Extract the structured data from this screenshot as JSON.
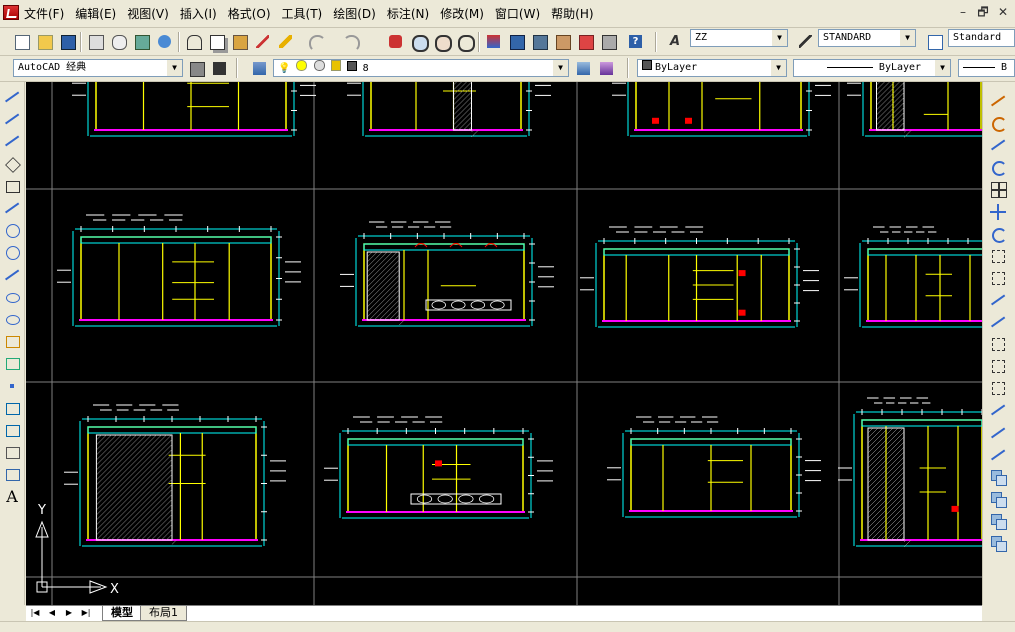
{
  "menu": {
    "items": [
      "文件(F)",
      "编辑(E)",
      "视图(V)",
      "插入(I)",
      "格式(O)",
      "工具(T)",
      "绘图(D)",
      "标注(N)",
      "修改(M)",
      "窗口(W)",
      "帮助(H)"
    ],
    "window_controls": [
      "–",
      "🗗",
      "✕"
    ]
  },
  "toolbar1": {
    "text_style": "ZZ",
    "dim_style": "STANDARD",
    "table_style": "Standard"
  },
  "toolbar2": {
    "workspace": "AutoCAD 经典",
    "layer": "8",
    "color": "ByLayer",
    "linetype": "ByLayer",
    "lineweight": "B"
  },
  "ucs": {
    "x_label": "X",
    "y_label": "Y"
  },
  "tabs": {
    "model": "模型",
    "layout": "布局1"
  },
  "colors": {
    "canvas": "#000000",
    "grid": "#808080",
    "yellow": "#ffff00",
    "cyan": "#00ffff",
    "red": "#ff0000",
    "magenta": "#ff00ff",
    "white": "#ffffff"
  },
  "icons": {
    "left_tools": [
      "line-icon",
      "construction-line-icon",
      "polyline-icon",
      "polygon-icon",
      "rectangle-icon",
      "arc-icon",
      "circle-icon",
      "revision-cloud-icon",
      "spline-icon",
      "ellipse-icon",
      "ellipse-arc-icon",
      "insert-block-icon",
      "make-block-icon",
      "point-icon",
      "hatch-icon",
      "gradient-icon",
      "region-icon",
      "table-icon",
      "multiline-text-icon"
    ],
    "right_tools": [
      "erase-icon",
      "copy-icon",
      "mirror-icon",
      "offset-icon",
      "array-icon",
      "move-icon",
      "rotate-icon",
      "scale-icon",
      "stretch-icon",
      "trim-icon",
      "extend-icon",
      "break-at-point-icon",
      "break-icon",
      "join-icon",
      "chamfer-icon",
      "fillet-icon",
      "explode-icon",
      "draw-order-front-icon",
      "draw-order-back-icon",
      "bring-above-icon",
      "send-under-icon"
    ]
  }
}
